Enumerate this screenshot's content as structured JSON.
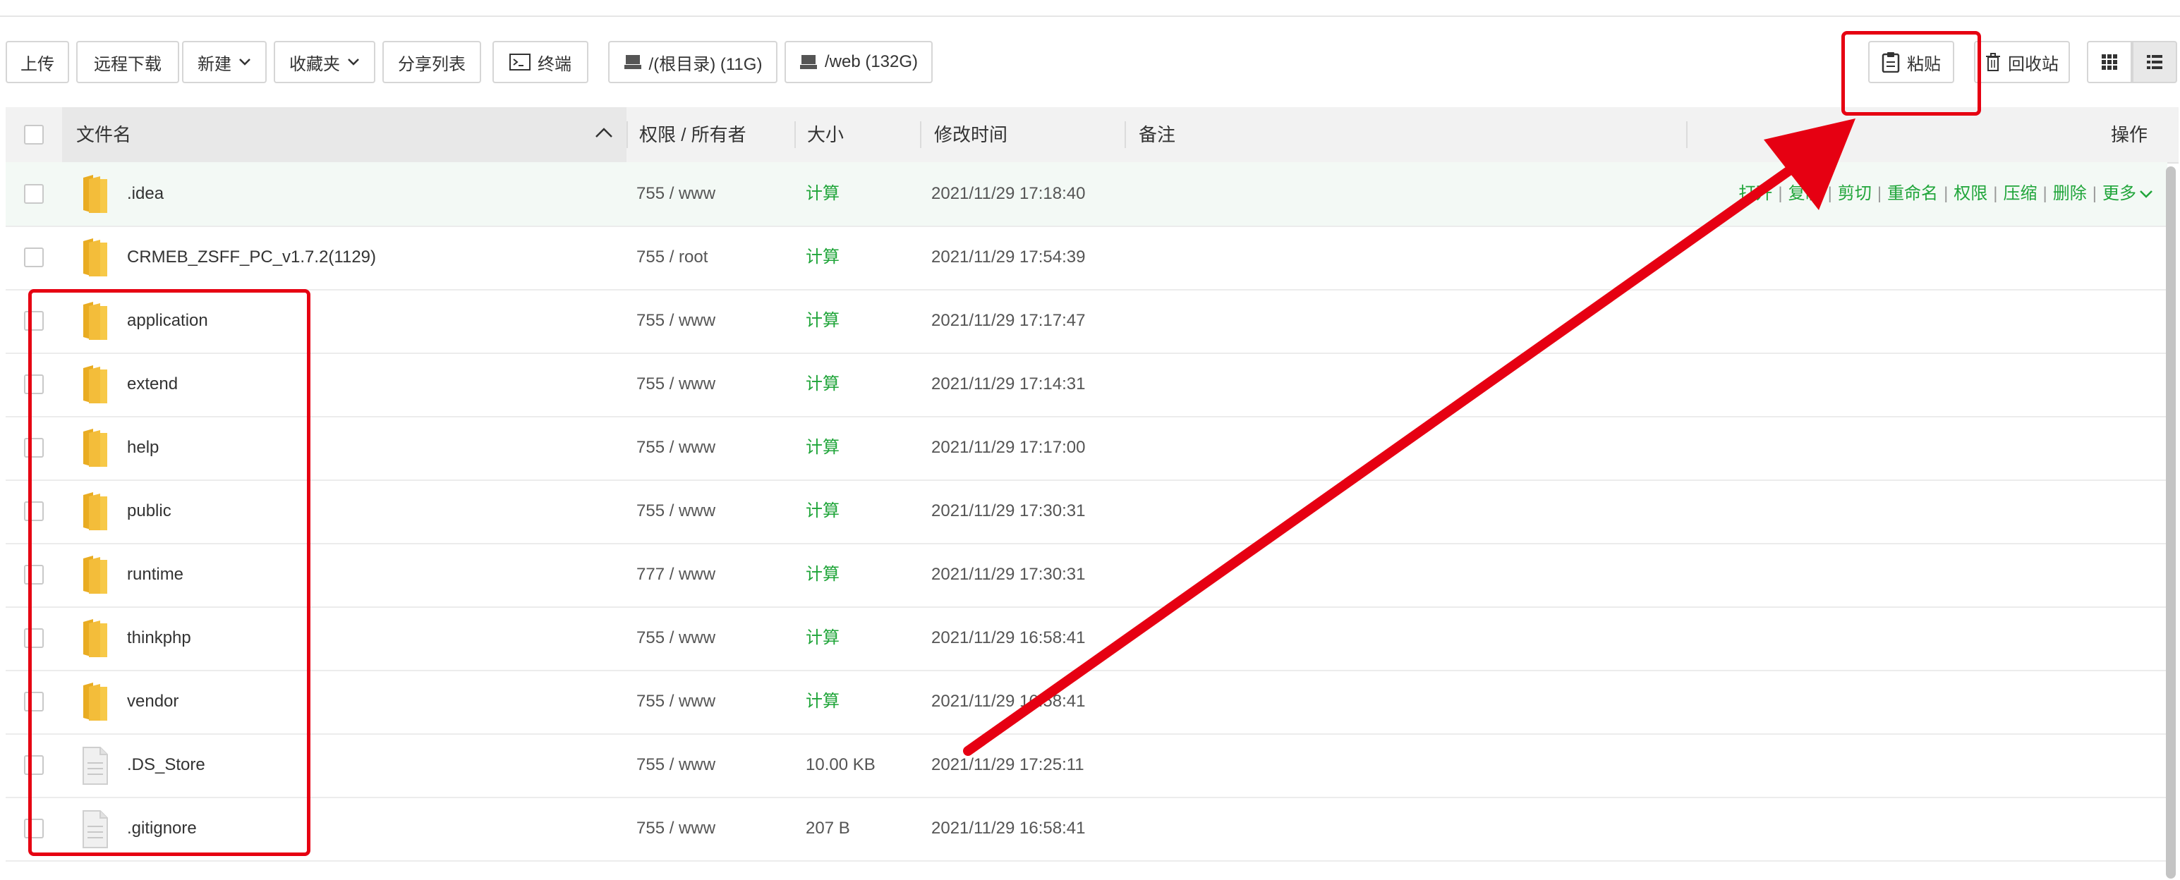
{
  "toolbar": {
    "upload": "上传",
    "remote_download": "远程下载",
    "new": "新建",
    "favorites": "收藏夹",
    "share_list": "分享列表",
    "terminal": "终端",
    "disk_root": "/(根目录) (11G)",
    "disk_web": "/web (132G)",
    "paste": "粘贴",
    "recycle": "回收站"
  },
  "table": {
    "headers": {
      "name": "文件名",
      "perm": "权限 / 所有者",
      "size": "大小",
      "mtime": "修改时间",
      "note": "备注",
      "ops": "操作"
    },
    "row_ops": [
      "打开",
      "复制",
      "剪切",
      "重命名",
      "权限",
      "压缩",
      "删除",
      "更多"
    ],
    "rows": [
      {
        "name": ".idea",
        "perm": "755 / www",
        "size": "计算",
        "mtime": "2021/11/29 17:18:40",
        "type": "folder"
      },
      {
        "name": "CRMEB_ZSFF_PC_v1.7.2(1129)",
        "perm": "755 / root",
        "size": "计算",
        "mtime": "2021/11/29 17:54:39",
        "type": "folder"
      },
      {
        "name": "application",
        "perm": "755 / www",
        "size": "计算",
        "mtime": "2021/11/29 17:17:47",
        "type": "folder"
      },
      {
        "name": "extend",
        "perm": "755 / www",
        "size": "计算",
        "mtime": "2021/11/29 17:14:31",
        "type": "folder"
      },
      {
        "name": "help",
        "perm": "755 / www",
        "size": "计算",
        "mtime": "2021/11/29 17:17:00",
        "type": "folder"
      },
      {
        "name": "public",
        "perm": "755 / www",
        "size": "计算",
        "mtime": "2021/11/29 17:30:31",
        "type": "folder"
      },
      {
        "name": "runtime",
        "perm": "777 / www",
        "size": "计算",
        "mtime": "2021/11/29 17:30:31",
        "type": "folder"
      },
      {
        "name": "thinkphp",
        "perm": "755 / www",
        "size": "计算",
        "mtime": "2021/11/29 16:58:41",
        "type": "folder"
      },
      {
        "name": "vendor",
        "perm": "755 / www",
        "size": "计算",
        "mtime": "2021/11/29 16:58:41",
        "type": "folder"
      },
      {
        "name": ".DS_Store",
        "perm": "755 / www",
        "size": "10.00 KB",
        "mtime": "2021/11/29 17:25:11",
        "type": "file"
      },
      {
        "name": ".gitignore",
        "perm": "755 / www",
        "size": "207 B",
        "mtime": "2021/11/29 16:58:41",
        "type": "file"
      }
    ]
  },
  "colors": {
    "accent_green": "#20a53a",
    "annotation_red": "#e60012",
    "folder_yellow": "#f7c948"
  },
  "icons": {
    "folder": "folder-icon",
    "file": "file-icon",
    "terminal": "terminal-icon",
    "disk": "disk-icon",
    "paste": "clipboard-icon",
    "recycle": "trash-icon",
    "grid_view": "grid-view-icon",
    "list_view": "list-view-icon"
  }
}
